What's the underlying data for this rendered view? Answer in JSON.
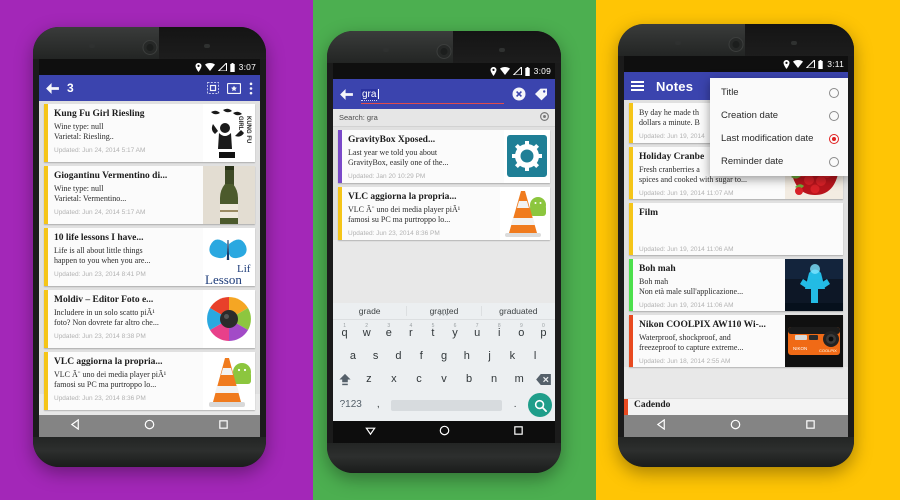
{
  "panels": {
    "left_bg": "#a327b8",
    "middle_bg": "#4caf50",
    "right_bg": "#ffc505",
    "accent_bar": "#3b44ae"
  },
  "phone1": {
    "statusbar": {
      "time": "3:07",
      "icons": [
        "location-pin-icon",
        "wifi-icon",
        "signal-icon",
        "battery-icon"
      ]
    },
    "actionbar": {
      "back_icon": "back-arrow-icon",
      "title": "3",
      "grid_icon": "grid-view-icon",
      "card_icon": "favorite-card-icon",
      "overflow_icon": "overflow-menu-icon"
    },
    "cards": [
      {
        "title": "Kung Fu Girl Riesling",
        "line1": "Wine type: null",
        "line2": "Varietal: Riesling..",
        "updated": "Updated: Jun 24, 2014 5:17 AM",
        "stripe": "#f5c518",
        "thumb": "kung-fu-girl-label-thumb"
      },
      {
        "title": "Giogantinu Vermentino di...",
        "line1": "Wine type: null",
        "line2": "Varietal: Vermentino...",
        "updated": "Updated: Jun 24, 2014 5:17 AM",
        "stripe": "#f5c518",
        "thumb": "wine-bottle-thumb"
      },
      {
        "title": "10 life lessons I have...",
        "line1": "Life is all about little things",
        "line2": "happen to you when you are...",
        "updated": "Updated: Jun 23, 2014 8:41 PM",
        "stripe": "#f5c518",
        "thumb": "butterfly-life-lesson-thumb"
      },
      {
        "title": "Moldiv – Editor Foto e...",
        "line1": "Includere in un solo scatto piÃ¹",
        "line2": "foto? Non dovrete far altro che...",
        "updated": "Updated: Jun 23, 2014 8:38 PM",
        "stripe": "#f5c518",
        "thumb": "moldiv-color-wheel-thumb"
      },
      {
        "title": "VLC aggiorna la propria...",
        "line1": "VLC Ã¨ uno dei media player piÃ¹",
        "line2": "famosi su PC ma purtroppo lo...",
        "updated": "Updated: Jun 23, 2014 8:36 PM",
        "stripe": "#f5c518",
        "thumb": "vlc-cone-android-thumb"
      }
    ],
    "navbar": {
      "back_icon": "nav-back-triangle-icon",
      "home_icon": "nav-home-circle-icon",
      "recents_icon": "nav-recents-square-icon"
    }
  },
  "phone2": {
    "statusbar": {
      "time": "3:09",
      "icons": [
        "location-pin-icon",
        "wifi-icon",
        "signal-icon",
        "battery-icon"
      ]
    },
    "actionbar": {
      "back_icon": "back-arrow-icon",
      "query": "gra",
      "clear_icon": "clear-search-icon",
      "tag_icon": "tag-label-icon"
    },
    "search_hint": {
      "text": "Search: gra",
      "dismiss_icon": "dismiss-circle-icon"
    },
    "results": [
      {
        "title": "GravityBox Xposed...",
        "line1": "Last year we told you about",
        "line2": "GravityBox, easily one of the...",
        "updated": "Updated: Jan 20 10:29 PM",
        "stripe": "#7a49c9",
        "thumb": "gravitybox-gear-thumb"
      },
      {
        "title": "VLC aggiorna la propria...",
        "line1": "VLC Ã¨ uno dei media player piÃ¹",
        "line2": "famosi su PC ma purtroppo lo...",
        "updated": "Updated: Jun 23, 2014 8:36 PM",
        "stripe": "#f5c518",
        "thumb": "vlc-cone-android-thumb"
      }
    ],
    "keyboard": {
      "suggestions": [
        "grade",
        "granted",
        "graduated"
      ],
      "dots": "•••",
      "row1": [
        "q",
        "w",
        "e",
        "r",
        "t",
        "y",
        "u",
        "i",
        "o",
        "p"
      ],
      "row1_nums": [
        "1",
        "2",
        "3",
        "4",
        "5",
        "6",
        "7",
        "8",
        "9",
        "0"
      ],
      "row2": [
        "a",
        "s",
        "d",
        "f",
        "g",
        "h",
        "j",
        "k",
        "l"
      ],
      "row3": [
        "z",
        "x",
        "c",
        "v",
        "b",
        "n",
        "m"
      ],
      "shift_icon": "shift-key-icon",
      "backspace_icon": "backspace-key-icon",
      "symbols_label": "?123",
      "comma": ",",
      "period": ".",
      "search_icon": "keyboard-search-icon"
    },
    "navbar": {
      "back_icon": "nav-back-down-triangle-icon",
      "home_icon": "nav-home-circle-icon",
      "recents_icon": "nav-recents-square-icon"
    }
  },
  "phone3": {
    "statusbar": {
      "time": "3:11",
      "icons": [
        "location-pin-icon",
        "wifi-icon",
        "signal-icon",
        "battery-icon"
      ]
    },
    "actionbar": {
      "menu_icon": "hamburger-menu-icon",
      "title": "Notes"
    },
    "sort_menu": {
      "items": [
        {
          "label": "Title",
          "selected": false
        },
        {
          "label": "Creation date",
          "selected": false
        },
        {
          "label": "Last modification date",
          "selected": true
        },
        {
          "label": "Reminder date",
          "selected": false
        }
      ],
      "selected_color": "#e02020"
    },
    "cards": [
      {
        "title": "",
        "line1": "By day he made th",
        "line2": "dollars a minute. B",
        "updated": "Updated: Jun 19, 2014",
        "stripe": "#f5c518",
        "thumb": ""
      },
      {
        "title": "Holiday Cranbe",
        "line1": "Fresh cranberries a",
        "line2": "spices and cooked with sugar to...",
        "updated": "Updated: Jun 19, 2014 11:07 AM",
        "stripe": "#f5c518",
        "thumb": "cranberries-bowl-thumb"
      },
      {
        "title": "Film",
        "line1": "",
        "line2": "",
        "updated": "Updated: Jun 19, 2014 11:06 AM",
        "stripe": "#f5c518",
        "thumb": ""
      },
      {
        "title": "Boh mah",
        "line1": "Boh mah",
        "line2": "Non età male sull'applicazione...",
        "updated": "Updated: Jun 19, 2014 11:06 AM",
        "stripe": "#4ce04c",
        "thumb": "blue-neon-thumb"
      },
      {
        "title": "Nikon COOLPIX AW110 Wi-...",
        "line1": "Waterproof, shockproof, and",
        "line2": "freezeproof to capture extreme...",
        "updated": "Updated: Jun 18, 2014 2:55 AM",
        "stripe": "#e84a20",
        "thumb": "nikon-camera-thumb"
      },
      {
        "title": "Cadendo",
        "line1": "",
        "line2": "",
        "updated": "",
        "stripe": "#e84a20",
        "thumb": ""
      }
    ],
    "navbar": {
      "back_icon": "nav-back-triangle-icon",
      "home_icon": "nav-home-circle-icon",
      "recents_icon": "nav-recents-square-icon"
    }
  }
}
